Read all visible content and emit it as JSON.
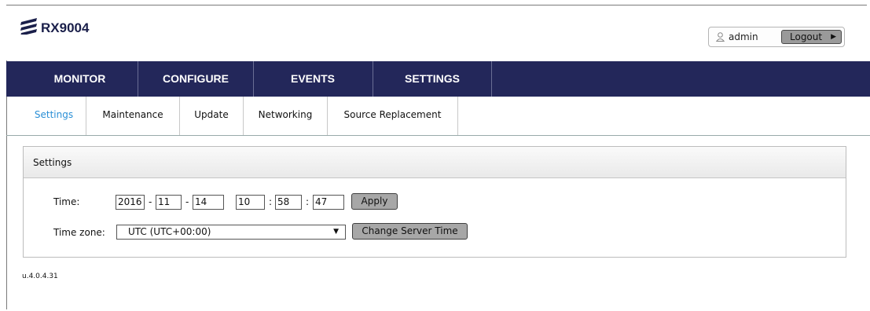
{
  "header": {
    "app_name": "RX9004",
    "user": "admin",
    "logout_label": "Logout",
    "user_icon": "user-icon",
    "brand_color": "#1a1f4a"
  },
  "nav": {
    "items": [
      {
        "label": "MONITOR"
      },
      {
        "label": "CONFIGURE"
      },
      {
        "label": "EVENTS"
      },
      {
        "label": "SETTINGS"
      }
    ],
    "bg_color": "#23275a"
  },
  "subnav": {
    "items": [
      {
        "label": "Settings",
        "active": true
      },
      {
        "label": "Maintenance"
      },
      {
        "label": "Update"
      },
      {
        "label": "Networking"
      },
      {
        "label": "Source Replacement"
      }
    ],
    "active_color": "#2a8fd6"
  },
  "settings_panel": {
    "title": "Settings",
    "time_label": "Time:",
    "year": "2016",
    "month": "11",
    "day": "14",
    "hour": "10",
    "minute": "58",
    "second": "47",
    "date_sep": "-",
    "time_sep": ":",
    "apply_label": "Apply",
    "timezone_label": "Time zone:",
    "timezone_value": "UTC (UTC+00:00)",
    "change_time_label": "Change Server Time"
  },
  "version": "u.4.0.4.31"
}
